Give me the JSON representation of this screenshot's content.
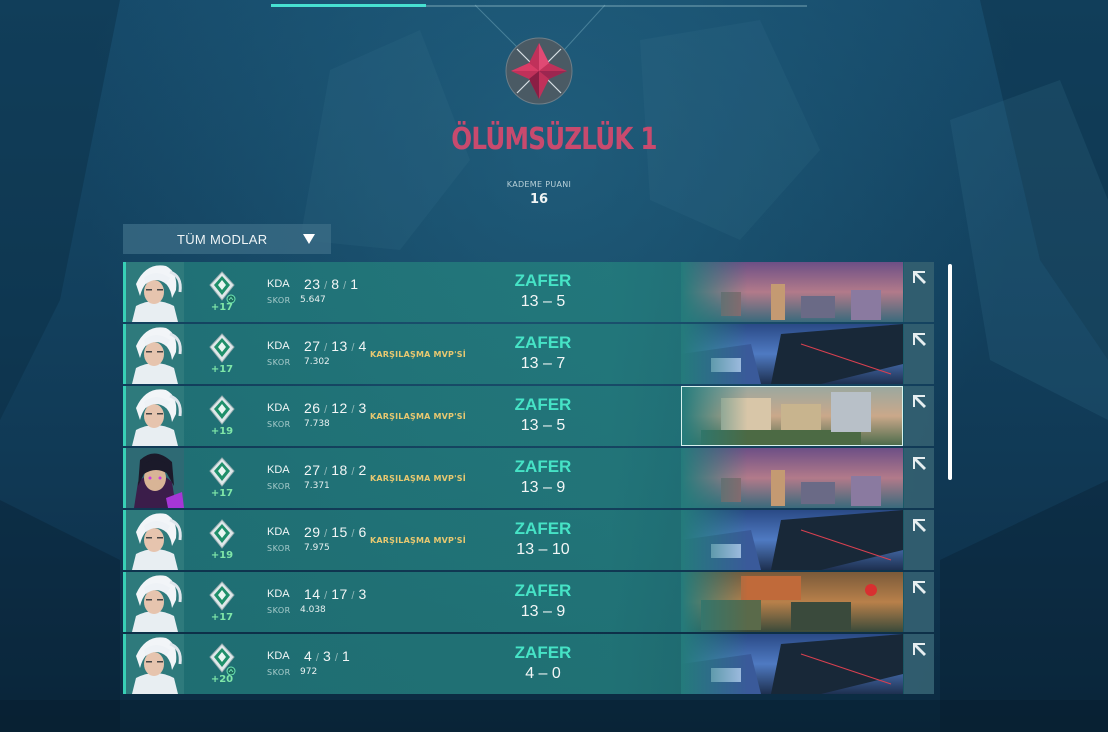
{
  "header": {
    "progress_fraction": 0.29,
    "rank_name": "ÖLÜMSÜZLÜK 1",
    "tier_points_label": "KADEME PUANI",
    "tier_points_value": "16"
  },
  "filter": {
    "mode_label": "TÜM MODLAR"
  },
  "colors": {
    "rank_name": "#c84a6e",
    "victory": "#46e3c6",
    "mvp": "#e8c870",
    "rr_gain": "#7fe6a8",
    "row_accent": "#38d0b6"
  },
  "labels": {
    "kda": "KDA",
    "score": "SKOR"
  },
  "matches": [
    {
      "agent": "jett",
      "rr": "+17",
      "rank_up_arrow": true,
      "k": "23",
      "d": "8",
      "a": "1",
      "score": "5.647",
      "mvp": "",
      "result": "ZAFER",
      "rounds_won": "13",
      "rounds_lost": "5",
      "map": "split",
      "selected": false
    },
    {
      "agent": "jett",
      "rr": "+17",
      "rank_up_arrow": false,
      "k": "27",
      "d": "13",
      "a": "4",
      "score": "7.302",
      "mvp": "KARŞILAŞMA MVP'Sİ",
      "result": "ZAFER",
      "rounds_won": "13",
      "rounds_lost": "7",
      "map": "icebox",
      "selected": false
    },
    {
      "agent": "jett",
      "rr": "+19",
      "rank_up_arrow": false,
      "k": "26",
      "d": "12",
      "a": "3",
      "score": "7.738",
      "mvp": "KARŞILAŞMA MVP'Sİ",
      "result": "ZAFER",
      "rounds_won": "13",
      "rounds_lost": "5",
      "map": "ascent",
      "selected": true
    },
    {
      "agent": "reyna",
      "rr": "+17",
      "rank_up_arrow": false,
      "k": "27",
      "d": "18",
      "a": "2",
      "score": "7.371",
      "mvp": "KARŞILAŞMA MVP'Sİ",
      "result": "ZAFER",
      "rounds_won": "13",
      "rounds_lost": "9",
      "map": "split",
      "selected": false
    },
    {
      "agent": "jett",
      "rr": "+19",
      "rank_up_arrow": false,
      "k": "29",
      "d": "15",
      "a": "6",
      "score": "7.975",
      "mvp": "KARŞILAŞMA MVP'Sİ",
      "result": "ZAFER",
      "rounds_won": "13",
      "rounds_lost": "10",
      "map": "icebox",
      "selected": false
    },
    {
      "agent": "jett",
      "rr": "+17",
      "rank_up_arrow": false,
      "k": "14",
      "d": "17",
      "a": "3",
      "score": "4.038",
      "mvp": "",
      "result": "ZAFER",
      "rounds_won": "13",
      "rounds_lost": "9",
      "map": "haven",
      "selected": false
    },
    {
      "agent": "jett",
      "rr": "+20",
      "rank_up_arrow": true,
      "k": "4",
      "d": "3",
      "a": "1",
      "score": "972",
      "mvp": "",
      "result": "ZAFER",
      "rounds_won": "4",
      "rounds_lost": "0",
      "map": "icebox",
      "selected": false
    }
  ]
}
